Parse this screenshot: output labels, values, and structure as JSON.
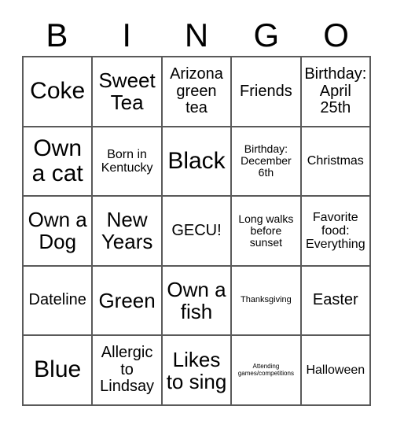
{
  "card": {
    "title": "BINGO",
    "header_letters": [
      "B",
      "I",
      "N",
      "G",
      "O"
    ],
    "rows": [
      [
        {
          "text": "Coke",
          "size": "fs-xl"
        },
        {
          "text": "Sweet Tea",
          "size": "fs-lg"
        },
        {
          "text": "Arizona green tea",
          "size": "fs-md"
        },
        {
          "text": "Friends",
          "size": "fs-md"
        },
        {
          "text": "Birthday: April 25th",
          "size": "fs-md"
        }
      ],
      [
        {
          "text": "Own a cat",
          "size": "fs-xl"
        },
        {
          "text": "Born in Kentucky",
          "size": "fs-sm"
        },
        {
          "text": "Black",
          "size": "fs-xl"
        },
        {
          "text": "Birthday: December 6th",
          "size": "fs-xs"
        },
        {
          "text": "Christmas",
          "size": "fs-sm"
        }
      ],
      [
        {
          "text": "Own a Dog",
          "size": "fs-lg"
        },
        {
          "text": "New Years",
          "size": "fs-lg"
        },
        {
          "text": "GECU!",
          "size": "fs-md"
        },
        {
          "text": "Long walks before sunset",
          "size": "fs-xs"
        },
        {
          "text": "Favorite food: Everything",
          "size": "fs-sm"
        }
      ],
      [
        {
          "text": "Dateline",
          "size": "fs-md"
        },
        {
          "text": "Green",
          "size": "fs-lg"
        },
        {
          "text": "Own a fish",
          "size": "fs-lg"
        },
        {
          "text": "Thanksgiving",
          "size": "fs-xxs"
        },
        {
          "text": "Easter",
          "size": "fs-md"
        }
      ],
      [
        {
          "text": "Blue",
          "size": "fs-xl"
        },
        {
          "text": "Allergic to Lindsay",
          "size": "fs-md"
        },
        {
          "text": "Likes to sing",
          "size": "fs-lg"
        },
        {
          "text": "Attending games/competitions",
          "size": "fs-tiny"
        },
        {
          "text": "Halloween",
          "size": "fs-sm"
        }
      ]
    ]
  },
  "colors": {
    "background": "#ffffff",
    "text": "#000000",
    "grid_line": "#5a5a5a"
  }
}
